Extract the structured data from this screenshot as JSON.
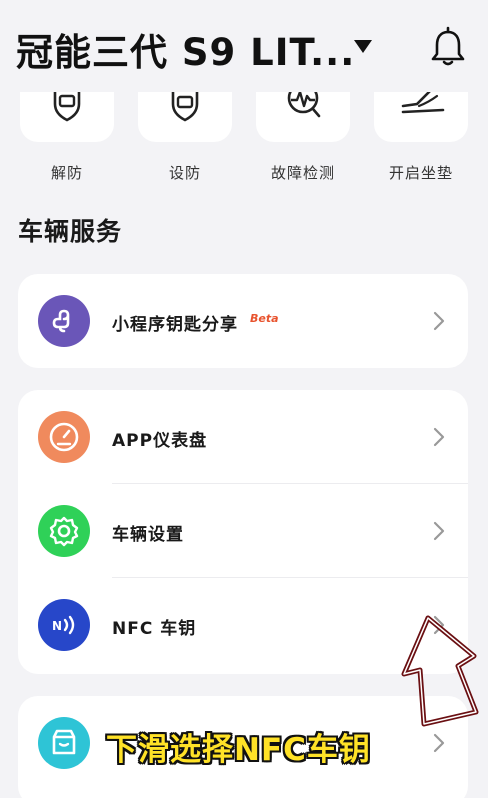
{
  "header": {
    "vehicle_title": "冠能三代 S9 LIT...",
    "bell_icon": "bell-icon"
  },
  "quick_actions": [
    {
      "label": "解防",
      "icon": "shield-unlock-icon"
    },
    {
      "label": "设防",
      "icon": "shield-lock-icon"
    },
    {
      "label": "故障检测",
      "icon": "diagnostics-icon"
    },
    {
      "label": "开启坐垫",
      "icon": "seat-icon"
    }
  ],
  "services": {
    "title": "车辆服务",
    "mini_program": {
      "label": "小程序钥匙分享",
      "badge": "Beta",
      "color": "#6a56b8"
    },
    "dashboard": {
      "label": "APP仪表盘",
      "color": "#f08a5d"
    },
    "settings": {
      "label": "车辆设置",
      "color": "#2fd158"
    },
    "nfc": {
      "label": "NFC 车钥",
      "color": "#2747c9"
    },
    "store": {
      "color": "#2ec4d6"
    }
  },
  "caption": "下滑选择NFC车钥"
}
